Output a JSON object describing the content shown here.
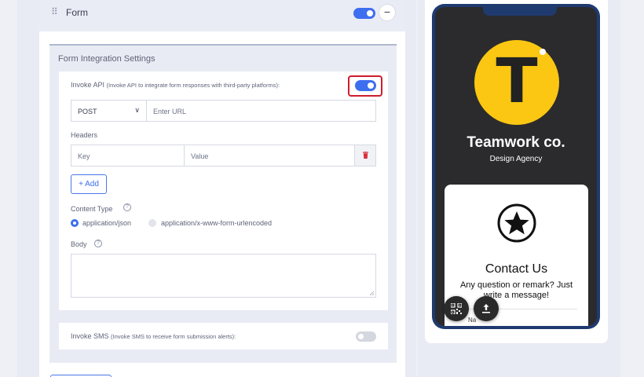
{
  "form_section": {
    "title": "Form",
    "drag_handle": "⠿",
    "collapse_icon": "−",
    "enabled": true
  },
  "integration": {
    "title": "Form Integration Settings",
    "invoke_api": {
      "label": "Invoke API",
      "description": "(Invoke API to integrate form responses with third-party platforms):",
      "enabled": true,
      "method": "POST",
      "method_chevron": "∨",
      "url_placeholder": "Enter URL",
      "headers_label": "Headers",
      "key_placeholder": "Key",
      "value_placeholder": "Value",
      "add_button": "+ Add",
      "content_type_label": "Content Type",
      "content_types": [
        "application/json",
        "application/x-www-form-urlencoded"
      ],
      "content_type_selected": "application/json",
      "body_label": "Body",
      "help_icon": "?"
    },
    "invoke_sms": {
      "label": "Invoke SMS",
      "description": "(Invoke SMS to receive form submission alerts):",
      "enabled": false
    }
  },
  "preview": {
    "logo_letter": "T",
    "company": "Teamwork co.",
    "tagline": "Design Agency",
    "contact_title": "Contact Us",
    "contact_desc": "Any question or remark? Just write a message!",
    "name_peek": "Na",
    "icons": [
      "star-icon",
      "qr-code-icon",
      "share-upload-icon"
    ]
  },
  "colors": {
    "accent": "#3d6ef0",
    "focus_ring": "#d01c2c",
    "logo_yellow": "#fbc712",
    "phone_frame": "#1f3a6e"
  }
}
